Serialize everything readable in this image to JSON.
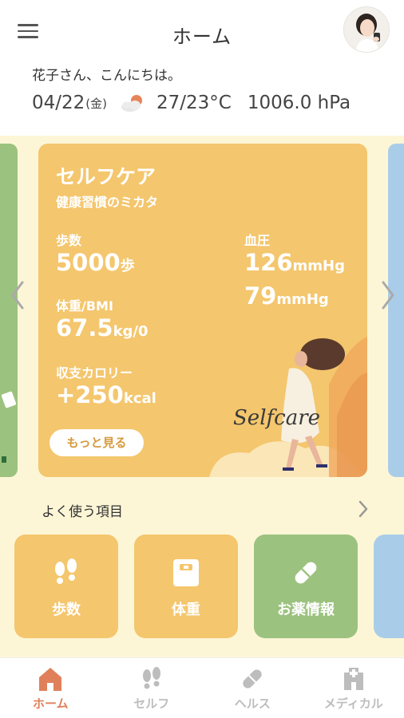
{
  "header": {
    "title": "ホーム",
    "menu_icon": "hamburger-menu-icon",
    "avatar": "user-avatar"
  },
  "greeting": "花子さん、こんにちは。",
  "weather": {
    "date": "04/22",
    "day_of_week": "(金)",
    "icon": "partly-cloudy-icon",
    "temperature": "27/23°C",
    "pressure": "1006.0 hPa"
  },
  "carousel": {
    "card": {
      "title": "セルフケア",
      "subtitle": "健康習慣のミカタ",
      "steps_label": "歩数",
      "steps_value": "5000",
      "steps_unit": "歩",
      "weight_label": "体重/BMI",
      "weight_value": "67.5",
      "weight_unit": "kg/0",
      "calorie_label": "収支カロリー",
      "calorie_value": "+250",
      "calorie_unit": "kcal",
      "bp_label": "血圧",
      "bp_systolic": "126",
      "bp_diastolic": "79",
      "bp_unit": "mmHg",
      "more_button": "もっと見る",
      "illustration_text": "Selfcare",
      "color": "#f4c66d"
    },
    "left_card_color": "#9cc27f",
    "right_card_color": "#a9cde8"
  },
  "frequent": {
    "title": "よく使う項目",
    "tiles": [
      {
        "label": "歩数",
        "icon": "footsteps-icon",
        "color": "#f4c66d"
      },
      {
        "label": "体重",
        "icon": "scale-icon",
        "color": "#f4c66d"
      },
      {
        "label": "お薬情報",
        "icon": "pill-icon",
        "color": "#9cc27f"
      }
    ]
  },
  "bottom_nav": {
    "items": [
      {
        "label": "ホーム",
        "icon": "home-icon",
        "active": true
      },
      {
        "label": "セルフ",
        "icon": "footsteps-icon",
        "active": false
      },
      {
        "label": "ヘルス",
        "icon": "pill-icon",
        "active": false
      },
      {
        "label": "メディカル",
        "icon": "hospital-icon",
        "active": false
      }
    ],
    "active_color": "#e0805a",
    "inactive_color": "#bdbdbd"
  }
}
